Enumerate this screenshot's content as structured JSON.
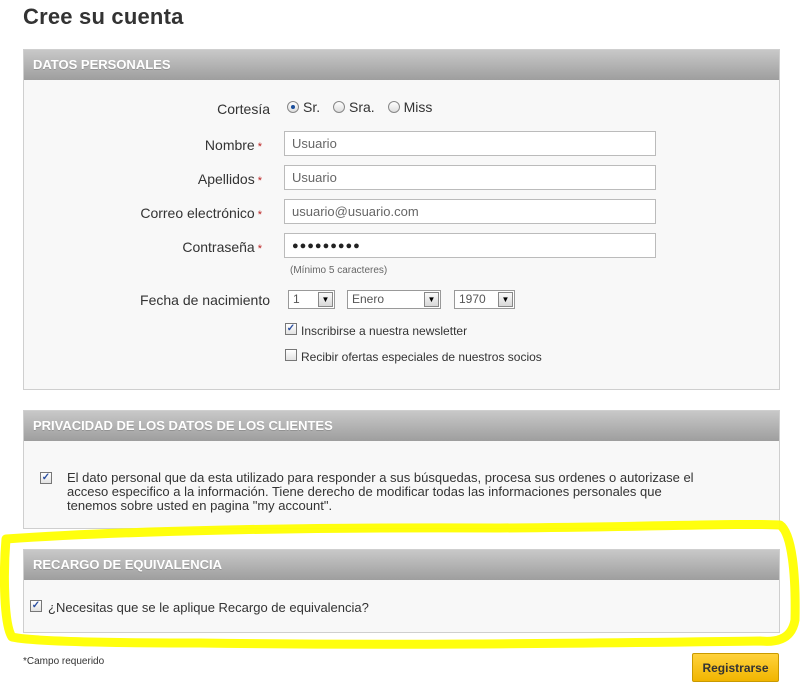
{
  "page": {
    "title": "Cree su cuenta"
  },
  "personal": {
    "header": "Datos personales",
    "courtesy": {
      "label": "Cortesía",
      "options": [
        "Sr.",
        "Sra.",
        "Miss"
      ],
      "selected": "Sr."
    },
    "first_name": {
      "label": "Nombre",
      "value": "Usuario"
    },
    "last_name": {
      "label": "Apellidos",
      "value": "Usuario"
    },
    "email": {
      "label": "Correo electrónico",
      "value": "usuario@usuario.com"
    },
    "password": {
      "label": "Contraseña",
      "value": "●●●●●●●●●",
      "hint": "(Mínimo 5 caracteres)"
    },
    "birthdate": {
      "label": "Fecha de nacimiento",
      "day": "1",
      "month": "Enero",
      "year": "1970"
    },
    "newsletter": {
      "label": "Inscribirse a nuestra newsletter",
      "checked": true
    },
    "partners": {
      "label": "Recibir ofertas especiales de nuestros socios",
      "checked": false
    },
    "required_marker": "*"
  },
  "privacy": {
    "header": "Privacidad de los datos de los clientes",
    "text": "El dato personal que da esta utilizado para responder a sus búsquedas, procesa sus ordenes o autorizase el acceso especifico a la información. Tiene derecho de modificar todas las informaciones personales que tenemos sobre usted en pagina \"my account\".",
    "checked": true
  },
  "recargo": {
    "header": "Recargo de equivalencia",
    "label": "¿Necesitas que se le aplique Recargo de equivalencia?",
    "checked": true
  },
  "footer": {
    "required_note": "*Campo requerido",
    "submit_label": "Registrarse"
  },
  "colors": {
    "highlight": "#ffff00",
    "button": "#f7c21a",
    "header_gradient_top": "#c8c8c8",
    "header_gradient_bottom": "#9e9e9e"
  },
  "icons": {
    "check": "✓",
    "dropdown": "▼"
  }
}
